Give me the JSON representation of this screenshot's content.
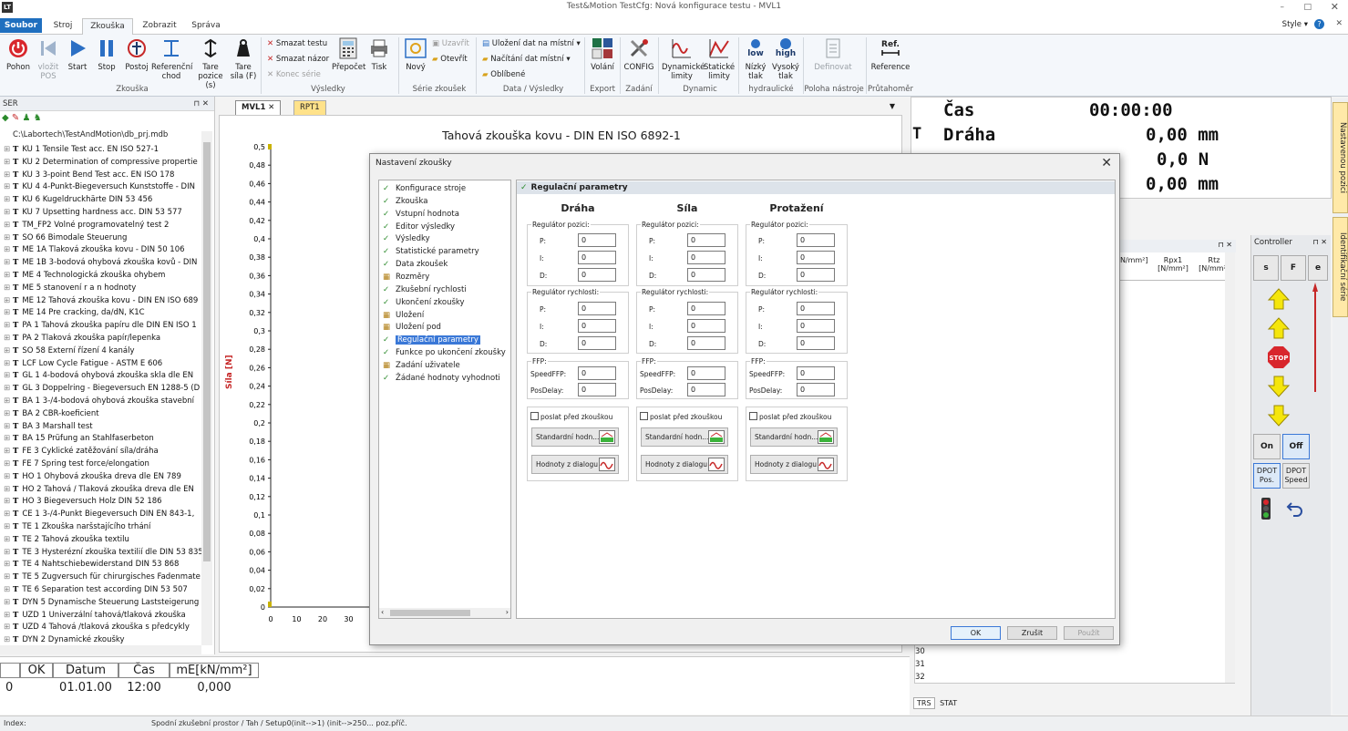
{
  "app": {
    "title": "Test&Motion  TestCfg: Nová konfigurace testu - MVL1",
    "style_label": "Style"
  },
  "menu_tabs": [
    "Soubor",
    "Stroj",
    "Zkouška",
    "Zobrazit",
    "Správa"
  ],
  "ribbon": {
    "zkouska": {
      "pohon": "Pohon",
      "vlozit_pos": "vložit POS",
      "start": "Start",
      "stop": "Stop",
      "postoj": "Postoj",
      "referencni": "Referenční chod",
      "tare_pozice": "Tare pozice (s)",
      "tare_sila": "Tare síla (F)",
      "group": "Zkouška"
    },
    "vysledky": {
      "smazat_test": "Smazat testu",
      "smazat_nazor": "Smazat názor",
      "konec_serie": "Konec série",
      "prepocet": "Přepočet",
      "tisk": "Tisk",
      "group": "Výsledky"
    },
    "serie": {
      "novy": "Nový",
      "uzavrit": "Uzavřít",
      "otevrit": "Otevřít",
      "group": "Série zkoušek"
    },
    "data": {
      "ulozeni": "Uložení dat na místní",
      "nacitani": "Načítání dat místní",
      "oblibene": "Oblíbené",
      "group": "Data / Výsledky"
    },
    "export": {
      "volani": "Volání",
      "group": "Export"
    },
    "zadani": {
      "config": "CONFIG",
      "group": "Zadání"
    },
    "dynamic": {
      "dyn_limity": "Dynamické limity",
      "stat_limity": "Statické limity",
      "group": "Dynamic"
    },
    "hydraulicke": {
      "low": "low",
      "high": "high",
      "nizky": "Nízký tlak",
      "vysoky": "Vysoký tlak",
      "group": "hydraulické"
    },
    "poloha": {
      "definovat": "Definovat",
      "group": "Poloha nástroje"
    },
    "prutahomer": {
      "ref": "Ref.",
      "reference": "Reference",
      "group": "Průtahoměr"
    }
  },
  "left_pane": {
    "header": "SER",
    "root": "C:\\Labortech\\TestAndMotion\\db_prj.mdb",
    "items": [
      "KU 1   Tensile Test acc. EN ISO 527-1",
      "KU 2   Determination of compressive propertie",
      "KU 3   3-point Bend Test acc. EN ISO 178",
      "KU 4   4-Punkt-Biegeversuch Kunststoffe - DIN",
      "KU 6   Kugeldruckhärte DIN 53 456",
      "KU 7   Upsetting hardness acc. DIN 53 577",
      "TM_FP2  Volné programovatelný test 2",
      "SO 66   Bimodale Steuerung",
      "ME 1A   Tlaková zkouška kovu - DIN 50 106",
      "ME 1B   3-bodová ohybová zkouška kovů - DIN",
      "ME 4   Technologická zkouška ohybem",
      "ME 5   stanovení r a n hodnoty",
      "ME 12   Tahová zkouška kovu - DIN EN ISO 689",
      "ME 14   Pre cracking, da/dN, K1C",
      "PA 1   Tahová zkouška papíru dle DIN EN ISO 1",
      "PA 2   Tlaková zkouška papír/lepenka",
      "SO 58   Externí řízení 4 kanály",
      "LCF   Low Cycle Fatigue - ASTM E 606",
      "GL 1   4-bodová ohybová zkouška skla dle  EN",
      "GL 3   Doppelring - Biegeversuch EN 1288-5 (D",
      "BA 1   3-/4-bodová ohybová zkouška stavební",
      "BA 2   CBR-koeficient",
      "BA 3   Marshall test",
      "BA 15   Prüfung an Stahlfaserbeton",
      "FE 3   Cyklické zatěžování síla/dráha",
      "FE 7   Spring test force/elongation",
      "HO 1   Ohybová zkouška dreva dle EN 789",
      "HO 2   Tahová / Tlaková zkouška dreva dle EN",
      "HO 3   Biegeversuch Holz  DIN 52 186",
      "CE 1   3-/4-Punkt Biegeversuch DIN EN 843-1,",
      "TE 1   Zkouška naršstajícího trhání",
      "TE 2   Tahová zkouška textilu",
      "TE 3   Hysterézní zkouška textilií dle DIN 53 835",
      "TE 4   Nahtschiebewiderstand DIN 53 868",
      "TE 5   Zugversuch für chirurgisches Fadenmate",
      "TE 6   Separation test according DIN 53 507",
      "DYN 5   Dynamische Steuerung Laststeigerung",
      "UZD 1   Univerzální tahová/tlaková zkouška",
      "UZD 4   Tahová /tlaková zkouška s předcykly",
      "DYN 2   Dynamické zkoušky"
    ]
  },
  "doc_tabs": [
    "MVL1",
    "RPT1"
  ],
  "graph": {
    "title": "Tahová zkouška kovu - DIN EN ISO 6892-1",
    "ylabel": "Síla [N]",
    "yticks": [
      "0,5",
      "0,48",
      "0,46",
      "0,44",
      "0,42",
      "0,4",
      "0,38",
      "0,36",
      "0,34",
      "0,32",
      "0,3",
      "0,28",
      "0,26",
      "0,24",
      "0,22",
      "0,2",
      "0,18",
      "0,16",
      "0,14",
      "0,12",
      "0,1",
      "0,08",
      "0,06",
      "0,04",
      "0,02",
      "0"
    ],
    "xticks": [
      "0",
      "10",
      "20",
      "30"
    ]
  },
  "bottom_table": {
    "headers": [
      "OK",
      "Datum",
      "Čas",
      "mE[kN/mm²]"
    ],
    "row": [
      "0",
      "01.01.00",
      "12:00",
      "0,000"
    ]
  },
  "status": {
    "index": "Index:",
    "path": "Spodní zkušební prostor / Tah / Setup0(init-->1)   (init-->250...   poz.příč."
  },
  "readouts": {
    "cas_label": "Čas",
    "cas_value": "00:00:00",
    "t_prefix": "T",
    "draha_label": "Dráha",
    "draha_value": "0,00 mm",
    "sila_value": "0,0 N",
    "prot_value": "0,00 mm"
  },
  "grid": {
    "headers": [
      "mE [N/mm²]",
      "Rpx1 [N/mm²]",
      "Rtz [N/mm²]"
    ],
    "rows": [
      "30",
      "31",
      "32"
    ],
    "tabs": [
      "TRS",
      "STAT"
    ]
  },
  "controller": {
    "title": "Controller",
    "s": "s",
    "f": "F",
    "e": "e",
    "on": "On",
    "off": "Off",
    "dpot_pos": "DPOT Pos.",
    "dpot_speed": "DPOT Speed",
    "stop": "STOP"
  },
  "side_tabs": [
    "Nastavenou pozici",
    "Identifikační série"
  ],
  "dialog": {
    "title": "Nastavení zkoušky",
    "nav": [
      "Konfigurace stroje",
      "Zkouška",
      "Vstupní hodnota",
      "Editor výsledky",
      "Výsledky",
      "Statistické parametry",
      "Data zkoušek",
      "Rozměry",
      "Zkušební rychlosti",
      "Ukončení zkoušky",
      "Uložení",
      "Uložení pod",
      "Regulační parametry",
      "Funkce po ukončení zkoušky",
      "Zadání uživatele",
      "Žádané hodnoty vyhodnoti"
    ],
    "selected": "Regulační parametry",
    "panel_title": "Regulační parametry",
    "columns": [
      "Dráha",
      "Síla",
      "Protažení"
    ],
    "reg_pos": "Regulátor pozici:",
    "reg_rych": "Regulátor rychlosti:",
    "ffp": "FFP:",
    "p": "P:",
    "i": "I:",
    "d": "D:",
    "speedffp": "SpeedFFP:",
    "posdelay": "PosDelay:",
    "value": "0",
    "poslat": "poslat před zkouškou",
    "std": "Standardní hodn...",
    "z_dialogu": "Hodnoty z dialogu",
    "ok": "OK",
    "zrusit": "Zrušit",
    "pouzit": "Použít"
  }
}
